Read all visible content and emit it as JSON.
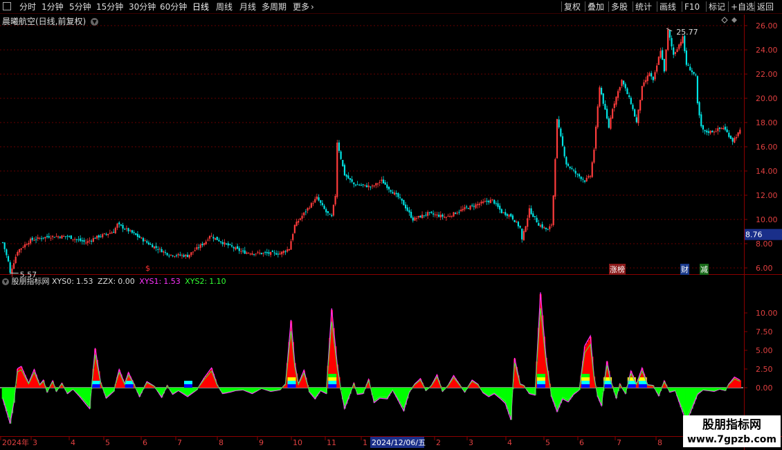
{
  "toolbar": {
    "left": [
      {
        "id": "intraday",
        "label": "分时"
      },
      {
        "id": "1min",
        "label": "1分钟"
      },
      {
        "id": "5min",
        "label": "5分钟"
      },
      {
        "id": "15min",
        "label": "15分钟"
      },
      {
        "id": "30min",
        "label": "30分钟"
      },
      {
        "id": "60min",
        "label": "60分钟"
      },
      {
        "id": "daily",
        "label": "日线",
        "active": true
      },
      {
        "id": "weekly",
        "label": "周线"
      },
      {
        "id": "monthly",
        "label": "月线"
      },
      {
        "id": "multi",
        "label": "多周期"
      },
      {
        "id": "more",
        "label": "更多"
      }
    ],
    "right": [
      {
        "id": "restore",
        "label": "复权"
      },
      {
        "id": "overlay",
        "label": "叠加"
      },
      {
        "id": "multi-stock",
        "label": "多股"
      },
      {
        "id": "stats",
        "label": "统计"
      },
      {
        "id": "draw",
        "label": "画线"
      },
      {
        "id": "f10",
        "label": "F10"
      },
      {
        "id": "mark",
        "label": "标记"
      },
      {
        "id": "add-watch",
        "label": "+自选"
      },
      {
        "id": "back",
        "label": "返回"
      }
    ]
  },
  "stock": {
    "title": "晨曦航空(日线,前复权)",
    "current_price": "8.76",
    "high_label": "25.77",
    "low_label": "5.57"
  },
  "price_axis": {
    "ticks": [
      "26.00",
      "24.00",
      "22.00",
      "20.00",
      "18.00",
      "16.00",
      "14.00",
      "12.00",
      "10.00",
      "8.00",
      "6.00"
    ]
  },
  "markers": {
    "s_marker": "$",
    "zhangbang": "涨榜",
    "cai": "财",
    "jian": "减"
  },
  "indicator": {
    "name": "股朋指标网",
    "xys0_label": "XYS0:",
    "xys0_value": "1.53",
    "zzx_label": "ZZX:",
    "zzx_value": "0.00",
    "xys1_label": "XYS1:",
    "xys1_value": "1.53",
    "xys2_label": "XYS2:",
    "xys2_value": "1.10",
    "axis_ticks": [
      "10.00",
      "7.50",
      "5.00",
      "2.50",
      "0.00"
    ],
    "colors": {
      "xys1": "#ff33ff",
      "xys2": "#33ff33",
      "zzx": "#ffffff"
    }
  },
  "time_axis": {
    "labels": [
      "2024年",
      "3",
      "4",
      "5",
      "6",
      "7",
      "8",
      "9",
      "10",
      "11",
      "1",
      "2",
      "3",
      "4",
      "5",
      "6",
      "7",
      "8"
    ],
    "highlight": "2024/12/06/五"
  },
  "watermark": {
    "name": "股朋指标网",
    "url": "www.7gpzb.com"
  },
  "colors": {
    "up": "#ff3c3c",
    "down": "#00e5e5",
    "grid": "#8b0000",
    "axis": "#8b0000",
    "volume_pos": "#ff0000",
    "volume_neg": "#00ff00"
  },
  "chart_data": {
    "type": "candlestick",
    "price_range": [
      5.0,
      26.5
    ],
    "price_anchors": [
      [
        0,
        8.1
      ],
      [
        3,
        6.5
      ],
      [
        4,
        5.57
      ],
      [
        8,
        7.4
      ],
      [
        15,
        8.3
      ],
      [
        25,
        8.6
      ],
      [
        35,
        8.6
      ],
      [
        45,
        8.1
      ],
      [
        50,
        8.5
      ],
      [
        60,
        9.0
      ],
      [
        62,
        9.6
      ],
      [
        70,
        8.9
      ],
      [
        80,
        7.9
      ],
      [
        90,
        7.1
      ],
      [
        100,
        7.0
      ],
      [
        110,
        8.2
      ],
      [
        112,
        8.7
      ],
      [
        120,
        8.0
      ],
      [
        130,
        7.3
      ],
      [
        140,
        7.2
      ],
      [
        150,
        7.2
      ],
      [
        155,
        7.6
      ],
      [
        158,
        9.5
      ],
      [
        165,
        10.9
      ],
      [
        170,
        11.8
      ],
      [
        175,
        10.6
      ],
      [
        178,
        10.2
      ],
      [
        180,
        12.0
      ],
      [
        181,
        16.4
      ],
      [
        185,
        13.7
      ],
      [
        190,
        12.9
      ],
      [
        195,
        12.8
      ],
      [
        200,
        12.7
      ],
      [
        205,
        13.2
      ],
      [
        210,
        12.4
      ],
      [
        215,
        11.7
      ],
      [
        218,
        11.0
      ],
      [
        222,
        10.0
      ],
      [
        230,
        10.5
      ],
      [
        240,
        10.2
      ],
      [
        250,
        10.9
      ],
      [
        260,
        11.4
      ],
      [
        265,
        11.6
      ],
      [
        270,
        10.6
      ],
      [
        275,
        10.3
      ],
      [
        280,
        9.3
      ],
      [
        281,
        8.3
      ],
      [
        285,
        10.8
      ],
      [
        290,
        9.6
      ],
      [
        295,
        9.1
      ],
      [
        297,
        9.6
      ],
      [
        298,
        12.0
      ],
      [
        300,
        18.2
      ],
      [
        305,
        14.6
      ],
      [
        310,
        13.8
      ],
      [
        315,
        13.2
      ],
      [
        318,
        13.6
      ],
      [
        320,
        15.8
      ],
      [
        323,
        21.0
      ],
      [
        328,
        17.6
      ],
      [
        330,
        19.2
      ],
      [
        335,
        21.5
      ],
      [
        340,
        19.6
      ],
      [
        343,
        18.0
      ],
      [
        346,
        20.9
      ],
      [
        350,
        22.1
      ],
      [
        352,
        21.4
      ],
      [
        356,
        24.0
      ],
      [
        358,
        22.3
      ],
      [
        360,
        25.6
      ],
      [
        363,
        23.6
      ],
      [
        368,
        25.0
      ],
      [
        370,
        22.8
      ],
      [
        375,
        21.8
      ],
      [
        376,
        19.5
      ],
      [
        378,
        17.6
      ],
      [
        380,
        17.2
      ],
      [
        385,
        17.3
      ],
      [
        390,
        17.6
      ],
      [
        395,
        16.5
      ],
      [
        399,
        17.3
      ]
    ],
    "indicator_range": [
      -5.0,
      13.2
    ],
    "indicator_anchors": [
      [
        0,
        -1.5
      ],
      [
        4,
        -4.8
      ],
      [
        6,
        -2.0
      ],
      [
        8,
        2.5
      ],
      [
        10,
        2.8
      ],
      [
        14,
        0.6
      ],
      [
        17,
        2.4
      ],
      [
        20,
        0.4
      ],
      [
        22,
        1.0
      ],
      [
        24,
        -0.6
      ],
      [
        27,
        0.9
      ],
      [
        29,
        -0.5
      ],
      [
        32,
        0.6
      ],
      [
        35,
        -0.8
      ],
      [
        38,
        -0.2
      ],
      [
        42,
        -1.3
      ],
      [
        47,
        -2.8
      ],
      [
        50,
        5.2
      ],
      [
        53,
        0.7
      ],
      [
        56,
        -1.4
      ],
      [
        60,
        -0.5
      ],
      [
        63,
        2.4
      ],
      [
        66,
        0.5
      ],
      [
        68,
        2.0
      ],
      [
        71,
        0.5
      ],
      [
        74,
        -1.2
      ],
      [
        78,
        0.8
      ],
      [
        82,
        0.2
      ],
      [
        86,
        -1.3
      ],
      [
        89,
        0.3
      ],
      [
        92,
        -0.9
      ],
      [
        95,
        -0.4
      ],
      [
        100,
        -1.2
      ],
      [
        105,
        -0.3
      ],
      [
        109,
        1.3
      ],
      [
        113,
        2.6
      ],
      [
        116,
        0.4
      ],
      [
        119,
        -0.8
      ],
      [
        123,
        -0.6
      ],
      [
        126,
        -0.4
      ],
      [
        130,
        -0.3
      ],
      [
        135,
        -0.8
      ],
      [
        140,
        -0.1
      ],
      [
        145,
        -0.5
      ],
      [
        150,
        -0.3
      ],
      [
        153,
        0.5
      ],
      [
        156,
        8.9
      ],
      [
        158,
        3.3
      ],
      [
        160,
        0.5
      ],
      [
        163,
        2.3
      ],
      [
        166,
        -0.6
      ],
      [
        169,
        -1.5
      ],
      [
        172,
        -0.4
      ],
      [
        175,
        -0.8
      ],
      [
        178,
        10.4
      ],
      [
        181,
        3.1
      ],
      [
        183,
        -0.3
      ],
      [
        185,
        -2.8
      ],
      [
        187,
        -1.5
      ],
      [
        190,
        0.6
      ],
      [
        192,
        -0.9
      ],
      [
        195,
        -0.8
      ],
      [
        198,
        1.1
      ],
      [
        201,
        -2.0
      ],
      [
        204,
        -1.4
      ],
      [
        208,
        -1.5
      ],
      [
        211,
        -0.3
      ],
      [
        214,
        -1.7
      ],
      [
        217,
        -3.1
      ],
      [
        220,
        -0.6
      ],
      [
        223,
        0.5
      ],
      [
        226,
        1.2
      ],
      [
        229,
        -0.4
      ],
      [
        232,
        0.3
      ],
      [
        235,
        1.7
      ],
      [
        238,
        -0.5
      ],
      [
        241,
        0.3
      ],
      [
        244,
        1.6
      ],
      [
        247,
        0.5
      ],
      [
        250,
        -0.6
      ],
      [
        254,
        1.0
      ],
      [
        257,
        0.5
      ],
      [
        260,
        -0.7
      ],
      [
        263,
        -1.2
      ],
      [
        266,
        -0.8
      ],
      [
        269,
        -1.4
      ],
      [
        272,
        -2.1
      ],
      [
        275,
        -4.3
      ],
      [
        277,
        3.9
      ],
      [
        280,
        0.5
      ],
      [
        282,
        0.3
      ],
      [
        285,
        -0.8
      ],
      [
        288,
        -1.0
      ],
      [
        291,
        12.5
      ],
      [
        294,
        4.0
      ],
      [
        297,
        -1.2
      ],
      [
        300,
        -3.2
      ],
      [
        303,
        -1.5
      ],
      [
        306,
        -1.9
      ],
      [
        309,
        -0.9
      ],
      [
        312,
        -0.3
      ],
      [
        315,
        5.5
      ],
      [
        318,
        6.8
      ],
      [
        320,
        1.5
      ],
      [
        322,
        -1.2
      ],
      [
        324,
        -2.4
      ],
      [
        327,
        3.5
      ],
      [
        329,
        1.0
      ],
      [
        332,
        -1.4
      ],
      [
        334,
        0.5
      ],
      [
        337,
        -0.8
      ],
      [
        340,
        2.2
      ],
      [
        343,
        0.5
      ],
      [
        346,
        2.6
      ],
      [
        349,
        0.4
      ],
      [
        352,
        0.3
      ],
      [
        355,
        -1.1
      ],
      [
        358,
        0.9
      ],
      [
        361,
        -0.6
      ],
      [
        364,
        -0.4
      ],
      [
        367,
        -2.6
      ],
      [
        370,
        -4.6
      ],
      [
        373,
        -2.8
      ],
      [
        376,
        -0.9
      ],
      [
        379,
        -0.3
      ],
      [
        382,
        -0.4
      ],
      [
        385,
        -0.5
      ],
      [
        388,
        -0.2
      ],
      [
        391,
        -0.4
      ],
      [
        393,
        0.5
      ],
      [
        396,
        1.4
      ],
      [
        399,
        1.0
      ]
    ]
  }
}
